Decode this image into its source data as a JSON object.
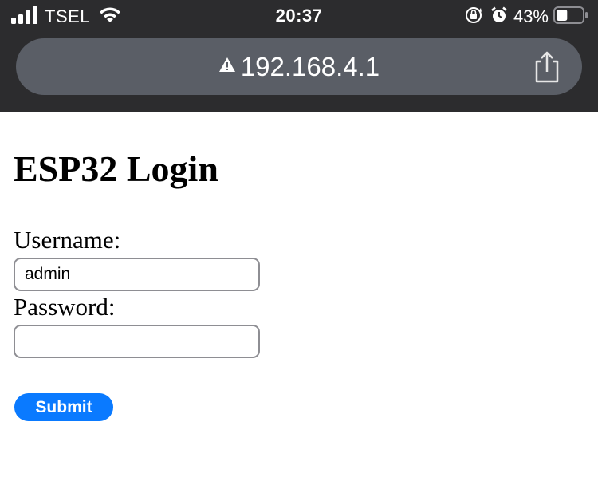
{
  "status_bar": {
    "carrier": "TSEL",
    "time": "20:37",
    "battery_percent": "43%",
    "signal_bars": 4,
    "battery_level": 0.43,
    "icons": [
      "signal-icon",
      "wifi-icon",
      "orientation-lock-icon",
      "alarm-icon",
      "battery-icon"
    ]
  },
  "address_bar": {
    "warning_icon": "warning-icon",
    "url": "192.168.4.1",
    "share_icon": "share-icon"
  },
  "page": {
    "title": "ESP32 Login",
    "username_label": "Username:",
    "username_value": "admin",
    "password_label": "Password:",
    "password_value": "",
    "submit_label": "Submit"
  },
  "colors": {
    "browser_chrome": "#2c2c2e",
    "address_bar": "#5a5e66",
    "submit_button": "#0a7aff"
  }
}
